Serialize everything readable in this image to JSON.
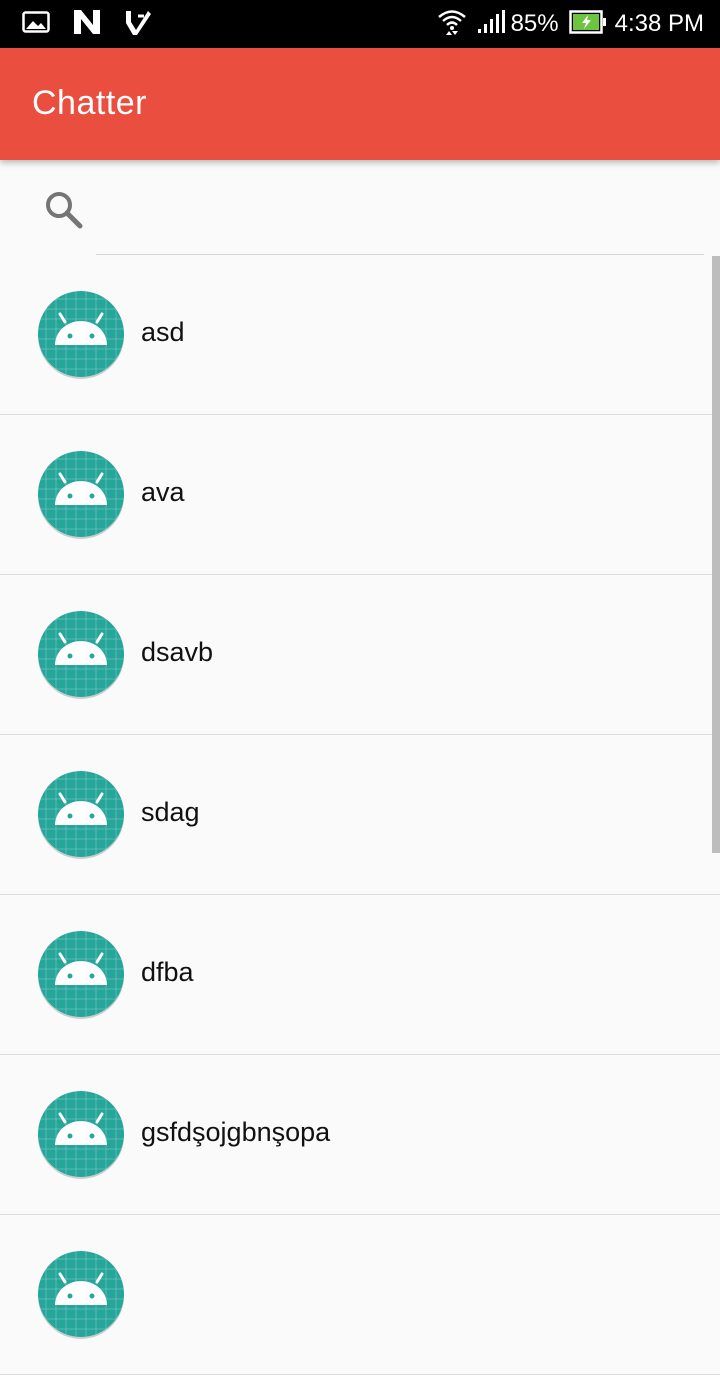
{
  "status_bar": {
    "battery_percent": "85%",
    "time": "4:38 PM",
    "icons": [
      "image-notification-icon",
      "n-app-icon",
      "checkmark-app-icon",
      "wifi-icon",
      "signal-icon",
      "battery-charging-icon"
    ]
  },
  "app_bar": {
    "title": "Chatter",
    "color": "#e94e3f"
  },
  "search": {
    "value": "",
    "placeholder": ""
  },
  "contacts": [
    {
      "name": "asd"
    },
    {
      "name": "ava"
    },
    {
      "name": "dsavb"
    },
    {
      "name": "sdag"
    },
    {
      "name": "dfba"
    },
    {
      "name": "gsfdşojgbnşopa"
    },
    {
      "name": ""
    }
  ],
  "colors": {
    "avatar": "#26a69a",
    "accent": "#e94e3f"
  }
}
